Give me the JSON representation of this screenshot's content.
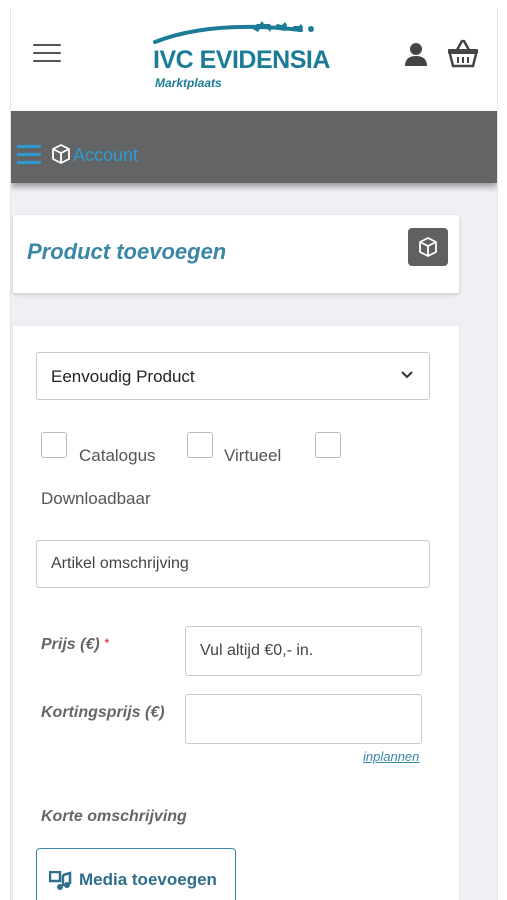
{
  "header": {
    "logo_title": "IVC EVIDENSIA",
    "logo_subtitle": "Marktplaats"
  },
  "account_bar": {
    "label": "Account"
  },
  "product": {
    "title": "Product toevoegen"
  },
  "form": {
    "product_type": "Eenvoudig Product",
    "checkboxes": [
      {
        "label": "Catalogus",
        "checked": false
      },
      {
        "label": "Virtueel",
        "checked": false
      },
      {
        "label": "Downloadbaar",
        "checked": false
      }
    ],
    "article_placeholder": "Artikel omschrijving",
    "price_label": "Prijs (€)",
    "price_required_mark": "*",
    "price_placeholder": "Vul altijd €0,- in.",
    "discount_label": "Kortingsprijs (€)",
    "discount_value": "",
    "schedule_link": "inplannen",
    "short_description_label": "Korte omschrijving",
    "media_button": "Media toevoegen"
  },
  "colors": {
    "brand": "#1c7b96",
    "account_bar": "#636466",
    "link": "#2e9bd1"
  },
  "icons": [
    "hamburger-icon",
    "user-icon",
    "basket-icon",
    "cube-icon",
    "chevron-down-icon",
    "media-icon"
  ]
}
